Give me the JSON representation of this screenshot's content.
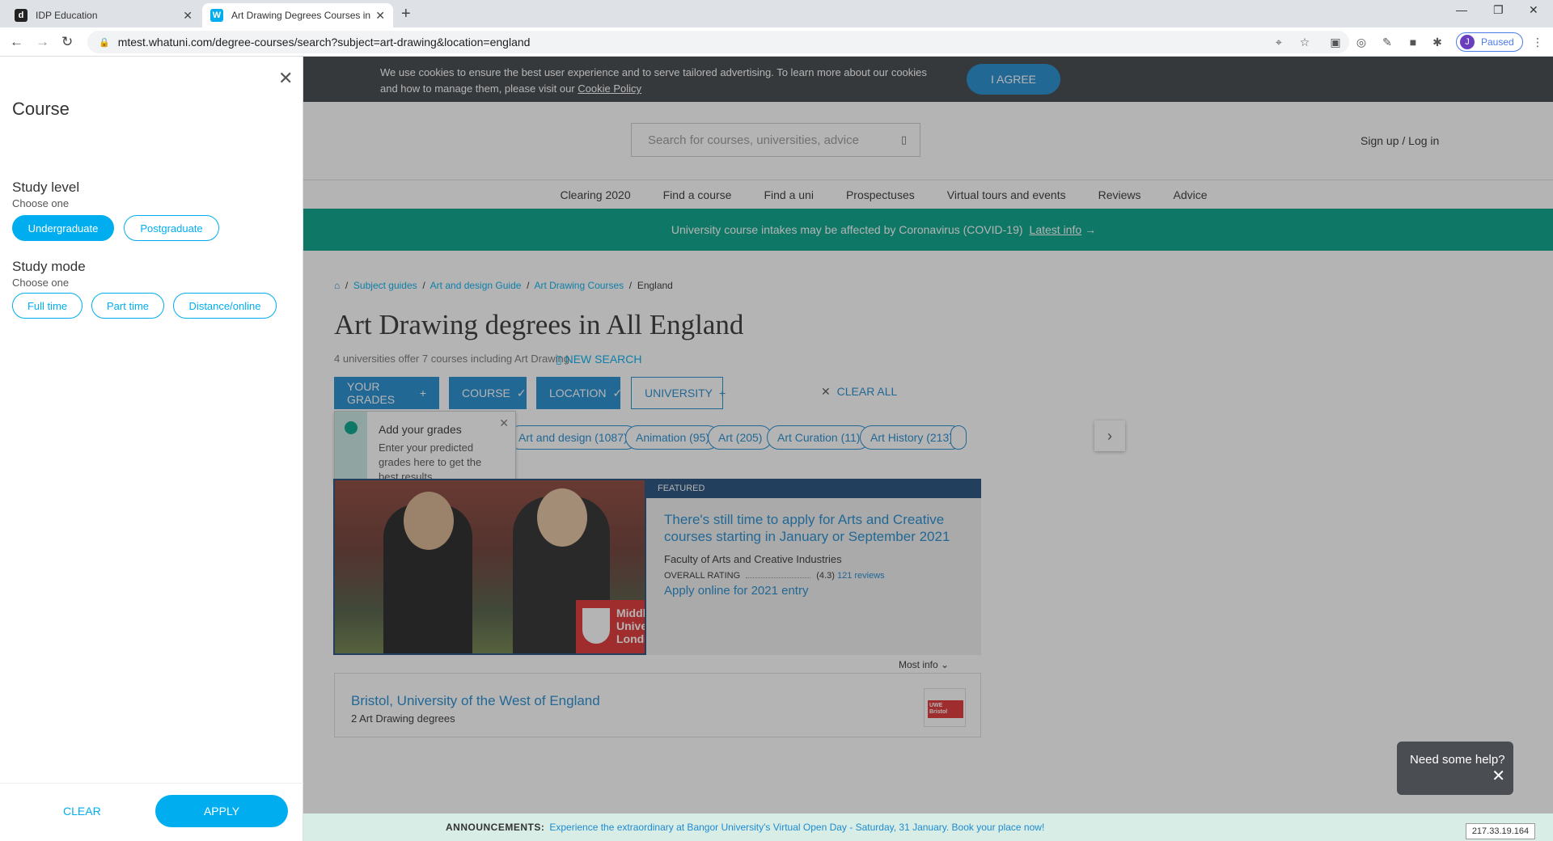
{
  "browser": {
    "tabs": [
      {
        "title": "IDP Education",
        "favicon": "d"
      },
      {
        "title": "Art Drawing Degrees Courses in E",
        "favicon": "W"
      }
    ],
    "url": "mtest.whatuni.com/degree-courses/search?subject=art-drawing&location=england",
    "profile_initial": "J",
    "profile_status": "Paused"
  },
  "filter_panel": {
    "title": "Course",
    "study_level": {
      "label": "Study level",
      "hint": "Choose one",
      "options": [
        "Undergraduate",
        "Postgraduate"
      ],
      "selected": "Undergraduate"
    },
    "study_mode": {
      "label": "Study mode",
      "hint": "Choose one",
      "options": [
        "Full time",
        "Part time",
        "Distance/online"
      ]
    },
    "clear_label": "CLEAR",
    "apply_label": "APPLY"
  },
  "cookie_banner": {
    "text": "We use cookies to ensure the best user experience and to serve tailored advertising. To learn more about our cookies and how to manage them, please visit our",
    "link": "Cookie Policy",
    "agree_label": "I AGREE"
  },
  "header": {
    "search_placeholder": "Search for courses, universities, advice",
    "signup_label": "Sign up / Log in",
    "nav": [
      "Clearing 2020",
      "Find a course",
      "Find a uni",
      "Prospectuses",
      "Virtual tours and events",
      "Reviews",
      "Advice"
    ]
  },
  "covid_banner": {
    "text": "University course intakes may be affected by Coronavirus (COVID-19)",
    "link": "Latest info"
  },
  "breadcrumb": [
    "Subject guides",
    "Art and design Guide",
    "Art Drawing Courses",
    "England"
  ],
  "results_header": {
    "title": "Art Drawing degrees in All England",
    "count": "4 universities offer 7 courses including Art Drawing",
    "new_search": "NEW SEARCH"
  },
  "filters": {
    "your_grades": "YOUR GRADES",
    "course": "COURSE",
    "location": "LOCATION",
    "university": "UNIVERSITY",
    "clear_all": "CLEAR ALL"
  },
  "grades_tooltip": {
    "title": "Add your grades",
    "body": "Enter your predicted grades here to get the best results"
  },
  "subject_chips": [
    "Art and design (1087)",
    "Animation (95)",
    "Art (205)",
    "Art Curation (11)",
    "Art History (213)"
  ],
  "featured": {
    "badge": "FEATURED",
    "title": "There's still time to apply for Arts and Creative courses starting in January or September 2021",
    "faculty": "Faculty of Arts and Creative Industries",
    "rating_label": "OVERALL RATING",
    "rating": "(4.3)",
    "reviews": "121 reviews",
    "apply": "Apply online for 2021 entry",
    "flag_text": "Middlesex University London"
  },
  "sort": {
    "label": "Most info"
  },
  "result": {
    "name": "Bristol, University of the West of England",
    "degrees": "2 Art Drawing degrees",
    "logo_text": "UWE Bristol"
  },
  "announcement": {
    "label": "ANNOUNCEMENTS:",
    "text": "Experience the extraordinary at Bangor University's Virtual Open Day - Saturday, 31 January. Book your place now!"
  },
  "help_widget": {
    "text": "Need some help?"
  },
  "ip": "217.33.19.164"
}
